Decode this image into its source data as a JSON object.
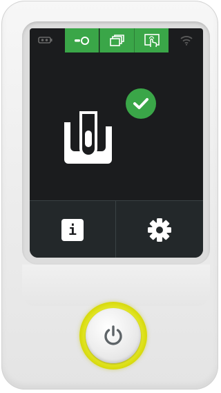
{
  "device": {
    "accent_color": "#3aa648",
    "screen_color": "#1b1c1e",
    "power_ring_color": "#e6ea2f"
  },
  "status_bar": {
    "left_icon": "battery-cassette-icon",
    "tabs": [
      {
        "icon": "cassette-tape-icon",
        "active": true
      },
      {
        "icon": "stacked-windows-icon",
        "active": true
      },
      {
        "icon": "touch-hand-icon",
        "active": true
      }
    ],
    "right_icon": "wifi-icon"
  },
  "main": {
    "status_icon": "check-icon",
    "device_icon": "tube-holder-icon"
  },
  "buttons": {
    "info_label": "i",
    "info_icon": "info-icon",
    "settings_icon": "gear-icon"
  },
  "power": {
    "icon": "power-icon"
  }
}
